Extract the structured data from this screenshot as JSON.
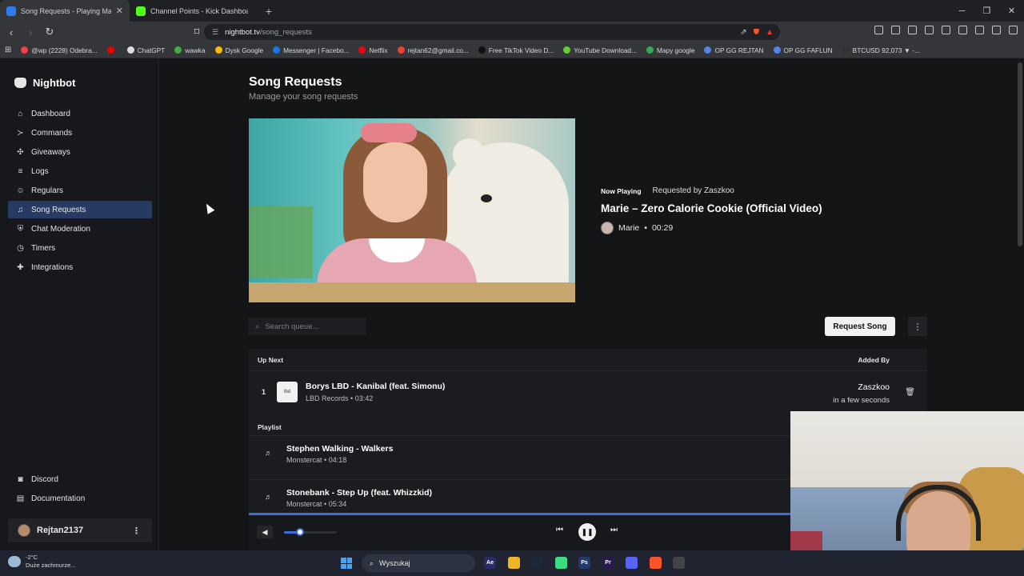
{
  "browser": {
    "tabs": [
      {
        "title": "Song Requests - Playing Ma",
        "favicon_color": "#2f7bf2",
        "active": true
      },
      {
        "title": "Channel Points - Kick Dashboard",
        "favicon_color": "#53fc18",
        "active": false
      }
    ],
    "url_host": "nightbot.tv",
    "url_path": "/song_requests",
    "bookmarks": [
      {
        "label": "@wp (2228) Odebra...",
        "color": "#e44"
      },
      {
        "label": "",
        "color": "#e00"
      },
      {
        "label": "ChatGPT",
        "color": "#ddd"
      },
      {
        "label": "wawka",
        "color": "#4a4"
      },
      {
        "label": "Dysk Google",
        "color": "#fbbc04"
      },
      {
        "label": "Messenger | Facebo...",
        "color": "#1877f2"
      },
      {
        "label": "Netflix",
        "color": "#e50914"
      },
      {
        "label": "rejtan62@gmail.co...",
        "color": "#ea4335"
      },
      {
        "label": "Free TikTok Video D...",
        "color": "#111"
      },
      {
        "label": "YouTube Download...",
        "color": "#6c3"
      },
      {
        "label": "Mapy google",
        "color": "#34a853"
      },
      {
        "label": "OP GG REJTAN",
        "color": "#5383e8"
      },
      {
        "label": "OP GG FAFLUN",
        "color": "#5383e8"
      },
      {
        "label": "BTCUSD 92,073 ▼ -...",
        "color": "#333"
      }
    ]
  },
  "app": {
    "brand": "Nightbot",
    "nav": [
      {
        "label": "Dashboard",
        "icon": "home-icon",
        "glyph": "⌂",
        "active": false
      },
      {
        "label": "Commands",
        "icon": "terminal-icon",
        "glyph": "≻",
        "active": false
      },
      {
        "label": "Giveaways",
        "icon": "gift-icon",
        "glyph": "✣",
        "active": false
      },
      {
        "label": "Logs",
        "icon": "list-icon",
        "glyph": "≡",
        "active": false
      },
      {
        "label": "Regulars",
        "icon": "users-icon",
        "glyph": "☺",
        "active": false
      },
      {
        "label": "Song Requests",
        "icon": "music-icon",
        "glyph": "♫",
        "active": true
      },
      {
        "label": "Chat Moderation",
        "icon": "shield-icon",
        "glyph": "⛨",
        "active": false
      },
      {
        "label": "Timers",
        "icon": "clock-icon",
        "glyph": "◷",
        "active": false
      },
      {
        "label": "Integrations",
        "icon": "puzzle-icon",
        "glyph": "✚",
        "active": false
      }
    ],
    "nav_bottom": [
      {
        "label": "Discord",
        "icon": "discord-icon",
        "glyph": "◙"
      },
      {
        "label": "Documentation",
        "icon": "book-icon",
        "glyph": "▤"
      }
    ],
    "user": {
      "name": "Rejtan2137"
    }
  },
  "page": {
    "title": "Song Requests",
    "subtitle": "Manage your song requests",
    "now_playing": {
      "badge": "Now Playing",
      "requested_by": "Requested by Zaszkoo",
      "title": "Marie – Zero Calorie Cookie (Official Video)",
      "artist": "Marie",
      "separator": "•",
      "time": "00:29"
    },
    "search_placeholder": "Search queue...",
    "request_button": "Request Song",
    "queue": {
      "up_next_label": "Up Next",
      "added_by_label": "Added By",
      "items": [
        {
          "position": "1",
          "title": "Borys LBD - Kanibal (feat. Simonu)",
          "channel": "LBD Records",
          "duration": "03:42",
          "added_by": "Zaszkoo",
          "added_when": "in a few seconds",
          "thumb_text": "lbd"
        }
      ]
    },
    "playlist": {
      "label": "Playlist",
      "items": [
        {
          "title": "Stephen Walking - Walkers",
          "channel": "Monstercat",
          "duration": "04:18"
        },
        {
          "title": "Stonebank - Step Up (feat. Whizzkid)",
          "channel": "Monstercat",
          "duration": "05:34"
        }
      ]
    },
    "player": {
      "volume": 0.3
    }
  },
  "taskbar": {
    "weather_temp": "-2°C",
    "weather_desc": "Duże zachmurze...",
    "search_label": "Wyszukaj",
    "apps": [
      {
        "name": "after-effects-icon",
        "label": "Ae",
        "color": "#2a2a6a"
      },
      {
        "name": "file-explorer-icon",
        "label": "",
        "color": "#f0b429"
      },
      {
        "name": "steam-icon",
        "label": "",
        "color": "#1b2838"
      },
      {
        "name": "android-studio-icon",
        "label": "",
        "color": "#3ddc84"
      },
      {
        "name": "photoshop-icon",
        "label": "Ps",
        "color": "#1f3a6b"
      },
      {
        "name": "premiere-icon",
        "label": "Pr",
        "color": "#2a1a4a"
      },
      {
        "name": "discord-icon",
        "label": "",
        "color": "#5865f2"
      },
      {
        "name": "brave-icon",
        "label": "",
        "color": "#fb542b"
      },
      {
        "name": "obs-icon",
        "label": "",
        "color": "#444"
      }
    ]
  }
}
